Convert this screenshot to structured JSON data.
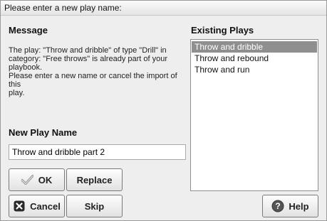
{
  "window": {
    "title": "Please enter a new play name:"
  },
  "message": {
    "heading": "Message",
    "lines": [
      "The play: \"Throw and dribble\" of type \"Drill\" in",
      "category: \"Free throws\" is already part of your",
      "playbook.",
      "Please enter a new name or cancel the import of this",
      "play."
    ]
  },
  "new_play": {
    "heading": "New Play Name",
    "value": "Throw and dribble part 2"
  },
  "existing_plays": {
    "heading": "Existing Plays",
    "items": [
      {
        "label": "Throw and dribble",
        "selected": true
      },
      {
        "label": "Throw and rebound",
        "selected": false
      },
      {
        "label": "Throw and run",
        "selected": false
      }
    ]
  },
  "buttons": {
    "ok": {
      "label": "OK",
      "icon": "checkmark-icon"
    },
    "replace": {
      "label": "Replace"
    },
    "cancel": {
      "label": "Cancel",
      "icon": "x-icon"
    },
    "skip": {
      "label": "Skip"
    },
    "help": {
      "label": "Help",
      "icon": "question-icon"
    }
  },
  "colors": {
    "selection": "#8f8f8f",
    "cancel_icon": "#2a2a2a"
  }
}
